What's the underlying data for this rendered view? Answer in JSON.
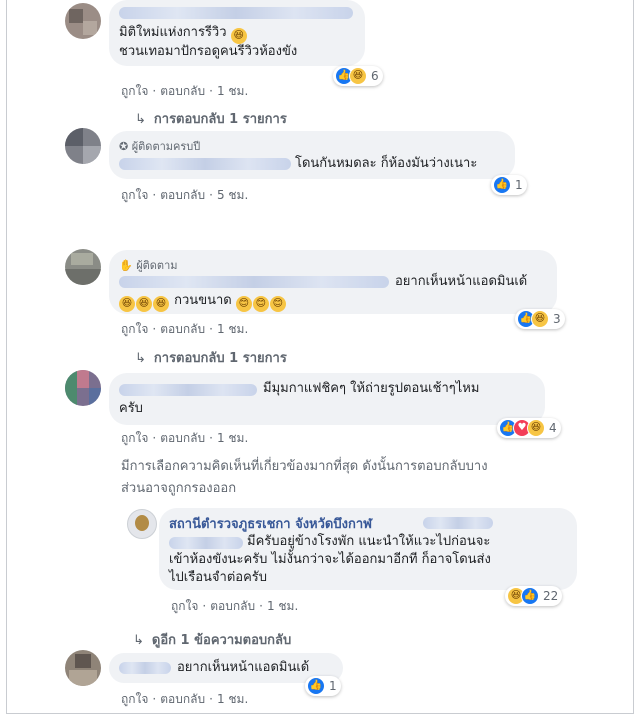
{
  "comments": [
    {
      "lines": [
        "มิติใหม่แห่งการรีวิว",
        "ชวนเทอมาปักรอดูคนรีวิวห้องขัง"
      ],
      "actions": {
        "like": "ถูกใจ",
        "reply": "ตอบกลับ",
        "time": "1 ชม."
      },
      "reaction_count": "6",
      "replies_label": "การตอบกลับ 1 รายการ"
    },
    {
      "badge": "ผู้ติดตามครบปี",
      "text": "โดนกันหมดละ ก็ห้องมันว่างเนาะ",
      "actions": {
        "like": "ถูกใจ",
        "reply": "ตอบกลับ",
        "time": "5 ชม."
      },
      "reaction_count": "1"
    },
    {
      "badge": "ผู้ติดตาม",
      "text": "อยากเห็นหน้าแอดมินเด้",
      "line2": "กวนขนาด",
      "actions": {
        "like": "ถูกใจ",
        "reply": "ตอบกลับ",
        "time": "1 ชม."
      },
      "reaction_count": "3",
      "replies_label": "การตอบกลับ 1 รายการ"
    },
    {
      "text": "มีมุมกาแฟชิคๆ ให้ถ่ายรูปตอนเช้าๆไหม",
      "line2": "ครับ",
      "actions": {
        "like": "ถูกใจ",
        "reply": "ตอบกลับ",
        "time": "1 ชม."
      },
      "reaction_count": "4"
    }
  ],
  "filter_note": [
    "มีการเลือกความคิดเห็นที่เกี่ยวข้องมากที่สุด ดังนั้นการตอบกลับบาง",
    "ส่วนอาจถูกกรองออก"
  ],
  "page_reply": {
    "author": "สถานีตำรวจภูธรเชกา จังหวัดบึงกาฬ",
    "lines": [
      "มีครับอยู่ข้างโรงพัก แนะนำให้แวะไปก่อนจะ",
      "เข้าห้องขังนะครับ ไม่งั้นกว่าจะได้ออกมาอีกที ก็อาจโดนส่ง",
      "ไปเรือนจำต่อครับ"
    ],
    "actions": {
      "like": "ถูกใจ",
      "reply": "ตอบกลับ",
      "time": "1 ชม."
    },
    "reaction_count": "22"
  },
  "more_replies": "ดูอีก 1 ข้อความตอบกลับ",
  "last_comment": {
    "text": "อยากเห็นหน้าแอดมินเด้",
    "actions": {
      "like": "ถูกใจ",
      "reply": "ตอบกลับ",
      "time": "1 ชม."
    },
    "reaction_count": "1"
  },
  "colors": {
    "like": "#1877f2",
    "link": "#385898",
    "bubble": "#f0f2f5"
  }
}
